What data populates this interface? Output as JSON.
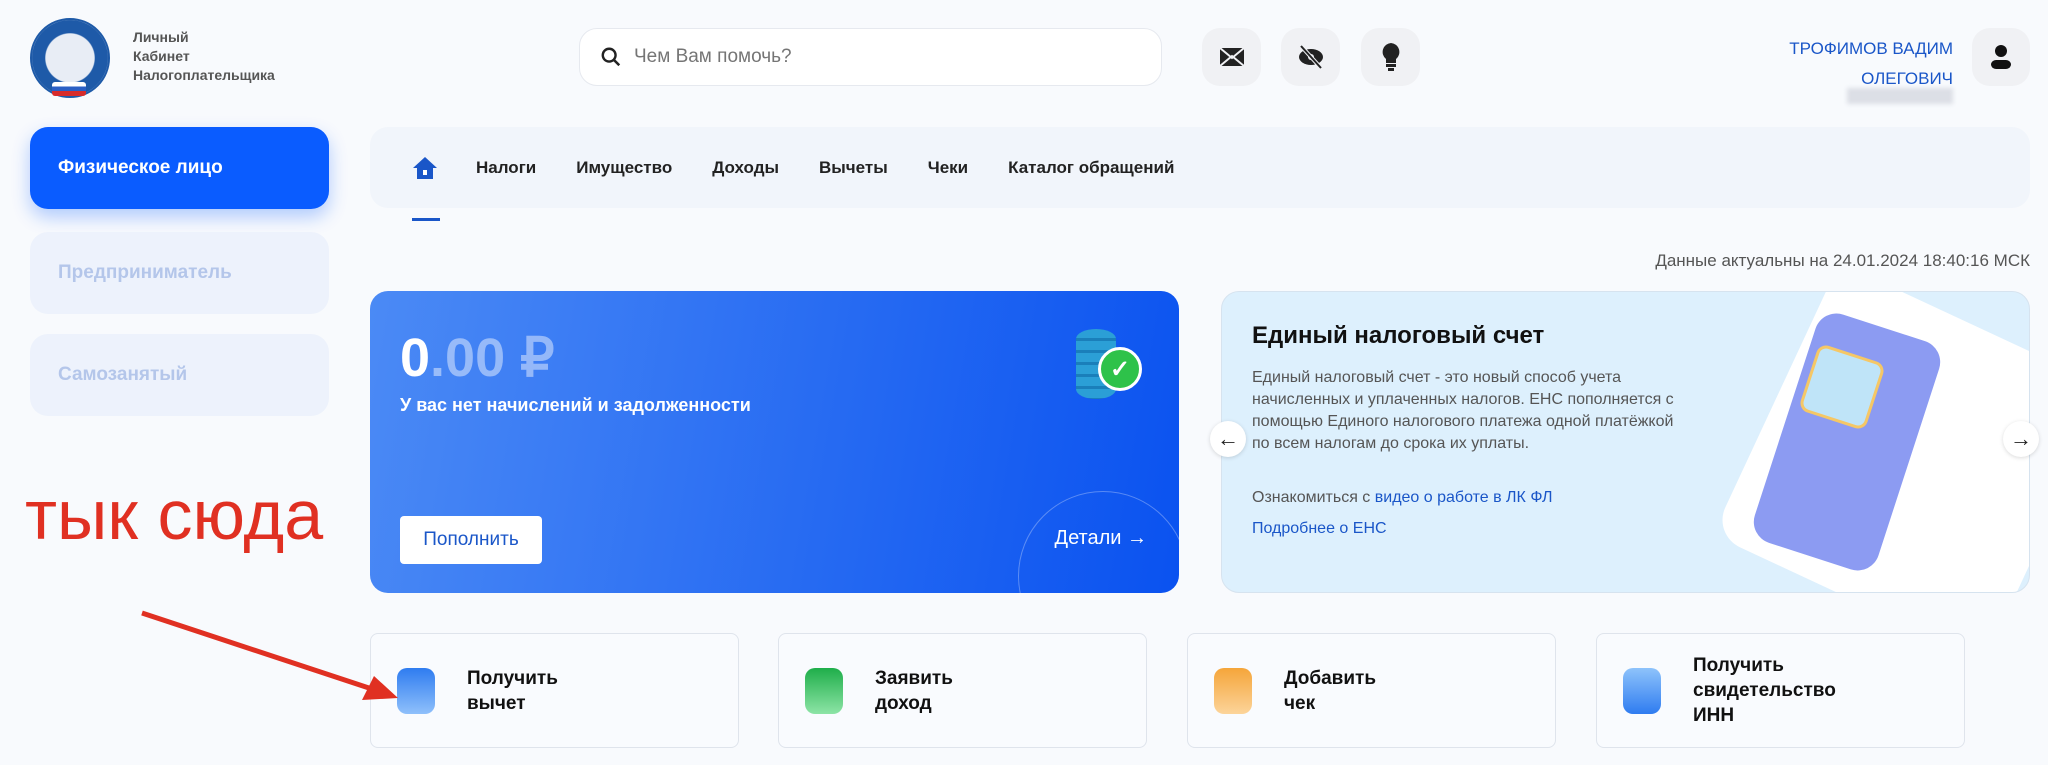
{
  "header": {
    "brand": "Личный\nКабинет\nНалогоплательщика",
    "brand_lines": [
      "Личный",
      "Кабинет",
      "Налогоплательщика"
    ],
    "search_placeholder": "Чем Вам помочь?",
    "user_name_line1": "ТРОФИМОВ ВАДИМ",
    "user_name_line2": "ОЛЕГОВИЧ"
  },
  "sidebar": {
    "items": [
      {
        "label": "Физическое лицо"
      },
      {
        "label": "Предприниматель"
      },
      {
        "label": "Самозанятый"
      }
    ]
  },
  "nav": {
    "items": [
      "Налоги",
      "Имущество",
      "Доходы",
      "Вычеты",
      "Чеки",
      "Каталог обращений"
    ]
  },
  "date_text": "Данные актуальны на 24.01.2024 18:40:16 МСК",
  "balance": {
    "amount_int": "0",
    "amount_frac": ".00 ₽",
    "status": "У вас нет начислений и задолженности",
    "topup": "Пополнить",
    "details": "Детали"
  },
  "ens": {
    "title": "Единый налоговый счет",
    "body": "Единый налоговый счет - это новый способ учета начисленных и уплаченных налогов. ЕНС пополняется с помощью Единого налогового платежа одной платёжкой по всем налогам до срока их уплаты.",
    "video_prefix": "Ознакомиться с ",
    "video_link": "видео о работе в ЛК ФЛ",
    "more_link": "Подробнее о ЕНС"
  },
  "actions": [
    {
      "label": "Получить\nвычет",
      "color": "#2f7cf0"
    },
    {
      "label": "Заявить\nдоход",
      "color": "#2fbf58"
    },
    {
      "label": "Добавить\nчек",
      "color": "#f5a53a"
    },
    {
      "label": "Получить\nсвидетельство\nИНН",
      "color": "#2f7cf0"
    }
  ],
  "annotation": "тык сюда",
  "colors": {
    "accent": "#0a5cff",
    "link": "#1a56c8",
    "annotation": "#e03022"
  }
}
